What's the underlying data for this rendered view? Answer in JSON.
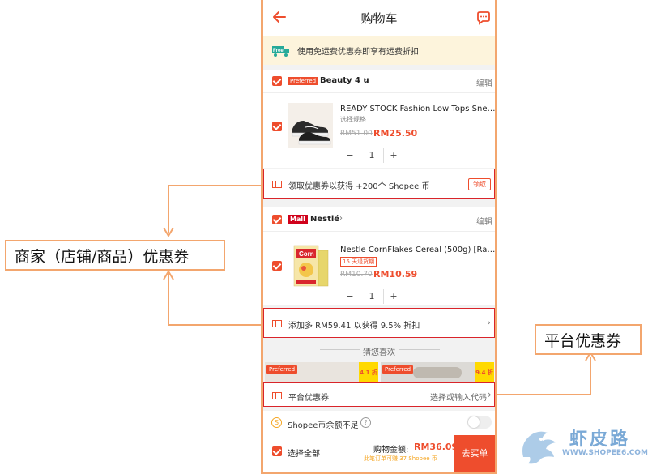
{
  "header": {
    "title": "购物车"
  },
  "banner": {
    "free_label": "Free",
    "text": "使用免运费优惠券即享有运费折扣"
  },
  "shops": [
    {
      "badge": "Preferred",
      "name": "Beauty 4 u",
      "edit": "编辑",
      "product": {
        "name": "READY STOCK Fashion Low Tops Sneak...",
        "variant": "选择规格",
        "old_price": "RM51.00",
        "price": "RM25.50",
        "qty": "1"
      },
      "voucher": {
        "text": "领取优惠券以获得 +200个 Shopee 币",
        "button": "领取"
      }
    },
    {
      "badge": "Mall",
      "name": "Nestlé",
      "edit": "编辑",
      "product": {
        "name": "Nestle CornFlakes Cereal (500g) [Raya...",
        "tag": "15 天退货期",
        "old_price": "RM10.70",
        "price": "RM10.59",
        "qty": "1"
      },
      "voucher": {
        "text": "添加多 RM59.41 以获得 9.5% 折扣"
      }
    }
  ],
  "recommend": {
    "title": "猜您喜欢",
    "tiles": [
      {
        "badge": "Preferred",
        "discount": "4.1 折"
      },
      {
        "badge": "Preferred",
        "discount": "9.4 折"
      }
    ]
  },
  "platform_voucher": {
    "label": "平台优惠券",
    "action": "选择或输入代码"
  },
  "coins": {
    "text": "Shopee币余额不足",
    "info": "?"
  },
  "footer": {
    "select_all": "选择全部",
    "total_label": "购物金额:",
    "total_value": "RM36.09",
    "coins_note": "此笔订单可赚 37 Shopee 币",
    "checkout": "去买单"
  },
  "annotations": {
    "shop_voucher": "商家（店铺/商品）优惠券",
    "platform_voucher": "平台优惠券"
  },
  "watermark": {
    "cn": "虾皮路",
    "url": "WWW.SHOPEE6.COM"
  },
  "colors": {
    "accent": "#ee4d2d",
    "callout": "#f3a66e",
    "highlight": "#d9242a"
  }
}
